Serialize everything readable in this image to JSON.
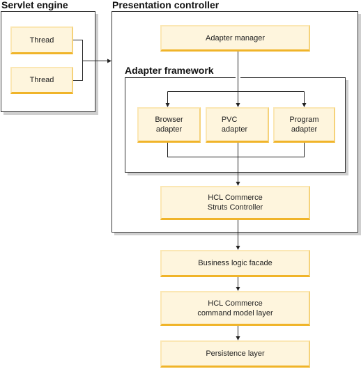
{
  "diagram": {
    "groups": {
      "servlet_engine": "Servlet engine",
      "presentation_controller": "Presentation controller",
      "adapter_framework": "Adapter framework"
    },
    "nodes": {
      "thread_1": "Thread",
      "thread_2": "Thread",
      "adapter_manager": "Adapter manager",
      "browser_adapter": "Browser\nadapter",
      "pvc_adapter": "PVC\nadapter",
      "program_adapter": "Program\nadapter",
      "struts_controller": "HCL Commerce\nStruts Controller",
      "business_logic_facade": "Business logic facade",
      "command_model_layer": "HCL Commerce\ncommand model layer",
      "persistence_layer": "Persistence layer"
    },
    "edges": [
      {
        "from": "thread_1",
        "to": "presentation_controller"
      },
      {
        "from": "thread_2",
        "to": "presentation_controller"
      },
      {
        "from": "adapter_manager",
        "to": "browser_adapter"
      },
      {
        "from": "adapter_manager",
        "to": "pvc_adapter"
      },
      {
        "from": "adapter_manager",
        "to": "program_adapter"
      },
      {
        "from": "browser_adapter",
        "to": "struts_controller"
      },
      {
        "from": "pvc_adapter",
        "to": "struts_controller"
      },
      {
        "from": "program_adapter",
        "to": "struts_controller"
      },
      {
        "from": "struts_controller",
        "to": "business_logic_facade"
      },
      {
        "from": "business_logic_facade",
        "to": "command_model_layer"
      },
      {
        "from": "command_model_layer",
        "to": "persistence_layer"
      }
    ],
    "colors": {
      "node_fill": "#fef5dd",
      "node_accent": "#f0b429",
      "line": "#222222",
      "frame_shadow": "#cfcfcf"
    }
  }
}
